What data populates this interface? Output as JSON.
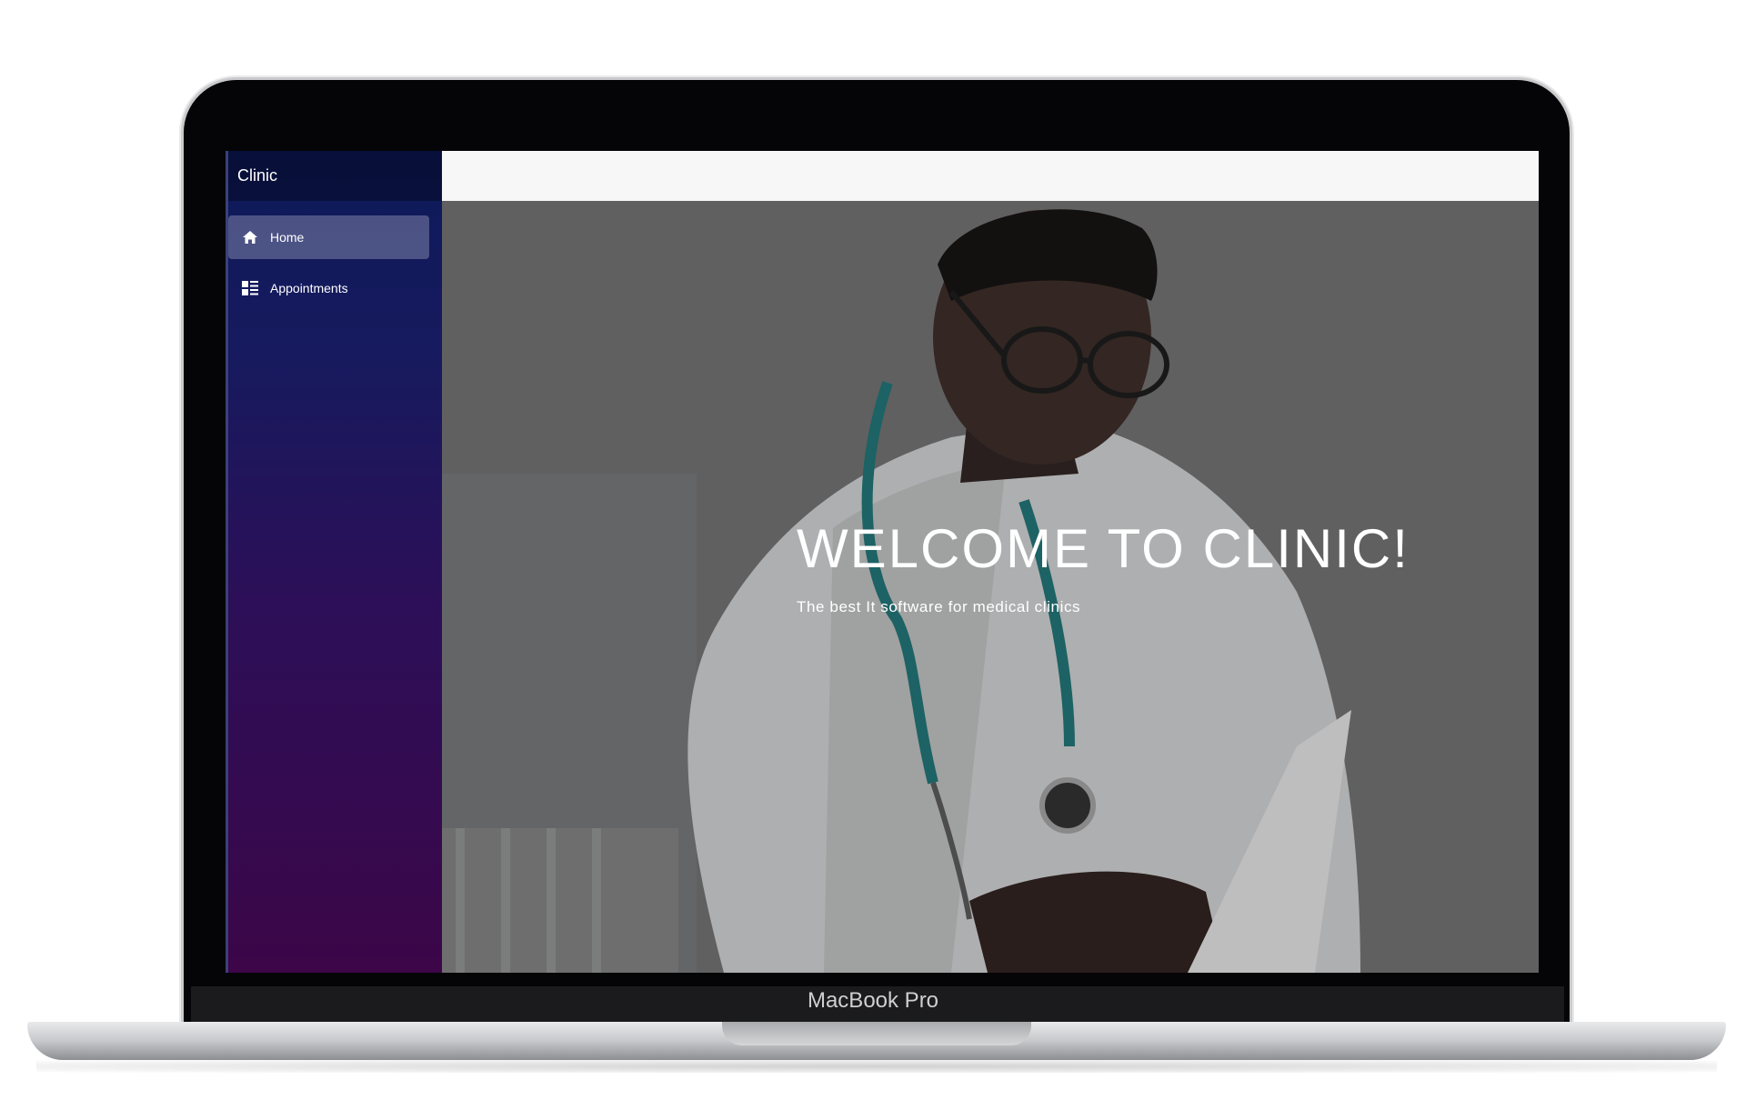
{
  "device": {
    "label": "MacBook Pro"
  },
  "sidebar": {
    "brand": "Clinic",
    "items": [
      {
        "label": "Home",
        "icon": "home-icon",
        "active": true
      },
      {
        "label": "Appointments",
        "icon": "dashboard-icon",
        "active": false
      }
    ]
  },
  "hero": {
    "title": "WELCOME TO CLINIC!",
    "subtitle": "The best It software for medical clinics"
  },
  "colors": {
    "sidebar_top": "#0c1a5a",
    "sidebar_bottom": "#3c0648",
    "topbar": "#f7f7f7",
    "active_item": "#4a5590"
  }
}
